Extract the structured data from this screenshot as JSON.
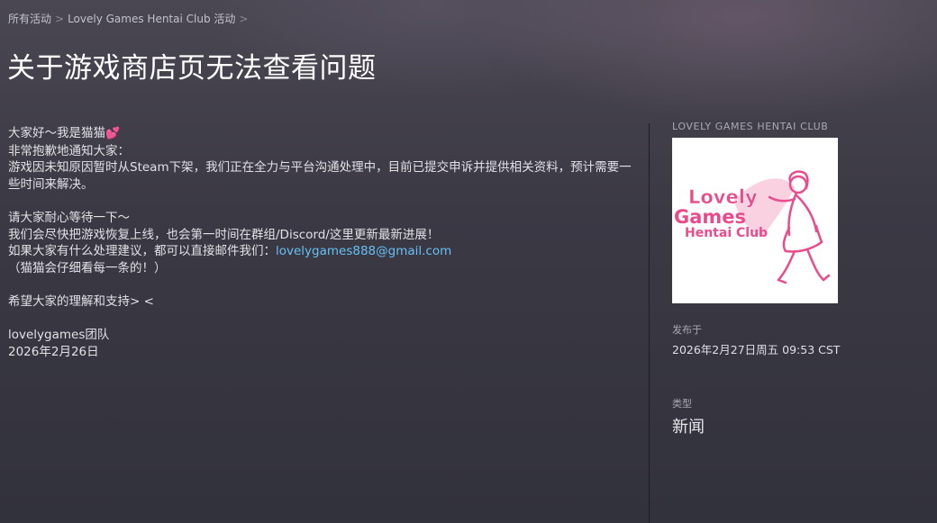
{
  "breadcrumb": {
    "item1": "所有活动",
    "item2": "Lovely Games Hentai Club 活动",
    "separator": ">"
  },
  "page_title": "关于游戏商店页无法查看问题",
  "post": {
    "line1": "大家好～我是猫猫",
    "line1_emoji": "💕",
    "line2": "非常抱歉地通知大家：",
    "line3": "游戏因未知原因暂时从Steam下架，我们正在全力与平台沟通处理中，目前已提交申诉并提供相关资料，预计需要一些时间来解决。",
    "line4": "请大家耐心等待一下～",
    "line5": "我们会尽快把游戏恢复上线，也会第一时间在群组/Discord/这里更新最新进展！",
    "line6_prefix": "如果大家有什么处理建议，都可以直接邮件我们：",
    "email": "lovelygames888@gmail.com",
    "line7": "（猫猫会仔细看每一条的！）",
    "line8": "希望大家的理解和支持> <",
    "signature": "lovelygames团队",
    "date": "2026年2月26日"
  },
  "sidebar": {
    "club_name": "LOVELY GAMES HENTAI CLUB",
    "logo": {
      "text_line1": "Lovely",
      "text_line2": "Games",
      "text_line3": "Hentai Club",
      "color": "#e94c8c"
    },
    "published_label": "发布于",
    "published_value": "2026年2月27日周五  09:53 CST",
    "type_label": "类型",
    "type_value": "新闻"
  }
}
